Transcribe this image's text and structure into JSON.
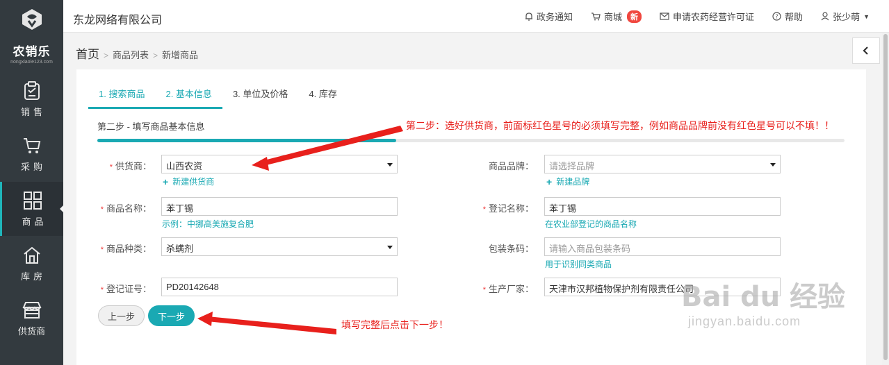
{
  "sidebar": {
    "brand_name": "农销乐",
    "brand_domain": "nongxiaole123.com",
    "items": [
      {
        "label": "销售",
        "icon": "clipboard-icon"
      },
      {
        "label": "采购",
        "icon": "cart-icon"
      },
      {
        "label": "商品",
        "icon": "grid-icon",
        "active": true
      },
      {
        "label": "库房",
        "icon": "warehouse-icon"
      },
      {
        "label": "供货商",
        "icon": "store-icon"
      }
    ]
  },
  "header": {
    "company": "东龙网络有限公司",
    "notice": "政务通知",
    "mall": "商城",
    "mall_badge": "新",
    "license": "申请农药经营许可证",
    "help": "帮助",
    "user": "张少萌"
  },
  "breadcrumb": {
    "home": "首页",
    "items": [
      "商品列表",
      "新增商品"
    ]
  },
  "tabs": [
    {
      "label": "1. 搜索商品",
      "done": true
    },
    {
      "label": "2. 基本信息",
      "done": true
    },
    {
      "label": "3. 单位及价格",
      "done": false
    },
    {
      "label": "4. 库存",
      "done": false
    }
  ],
  "step_title": "第二步 - 填写商品基本信息",
  "progress": 0.4,
  "form": {
    "supplier": {
      "label": "供货商：",
      "value": "山西农资",
      "add": "新建供货商"
    },
    "brand": {
      "label": "商品品牌：",
      "placeholder": "请选择品牌",
      "add": "新建品牌"
    },
    "product_name": {
      "label": "商品名称：",
      "value": "苯丁锡",
      "hint": "示例：中挪高美施复合肥"
    },
    "reg_name": {
      "label": "登记名称：",
      "value": "苯丁锡",
      "hint": "在农业部登记的商品名称"
    },
    "category": {
      "label": "商品种类：",
      "value": "杀螨剂"
    },
    "barcode": {
      "label": "包装条码：",
      "placeholder": "请输入商品包装条码",
      "hint": "用于识别同类商品"
    },
    "reg_no": {
      "label": "登记证号：",
      "value": "PD20142648"
    },
    "manufacturer": {
      "label": "生产厂家：",
      "value": "天津市汉邦植物保护剂有限责任公司"
    }
  },
  "buttons": {
    "prev": "上一步",
    "next": "下一步"
  },
  "annotations": {
    "top": "第二步：选好供货商，前面标红色星号的必须填写完整，例如商品品牌前没有红色星号可以不填！！",
    "bottom": "填写完整后点击下一步！"
  },
  "watermark": {
    "main": "Bai du 经验",
    "sub": "jingyan.baidu.com"
  },
  "colors": {
    "accent": "#1aa9b3",
    "sidebar": "#333a3f",
    "annotation": "#e8201c",
    "required": "#e33333"
  }
}
